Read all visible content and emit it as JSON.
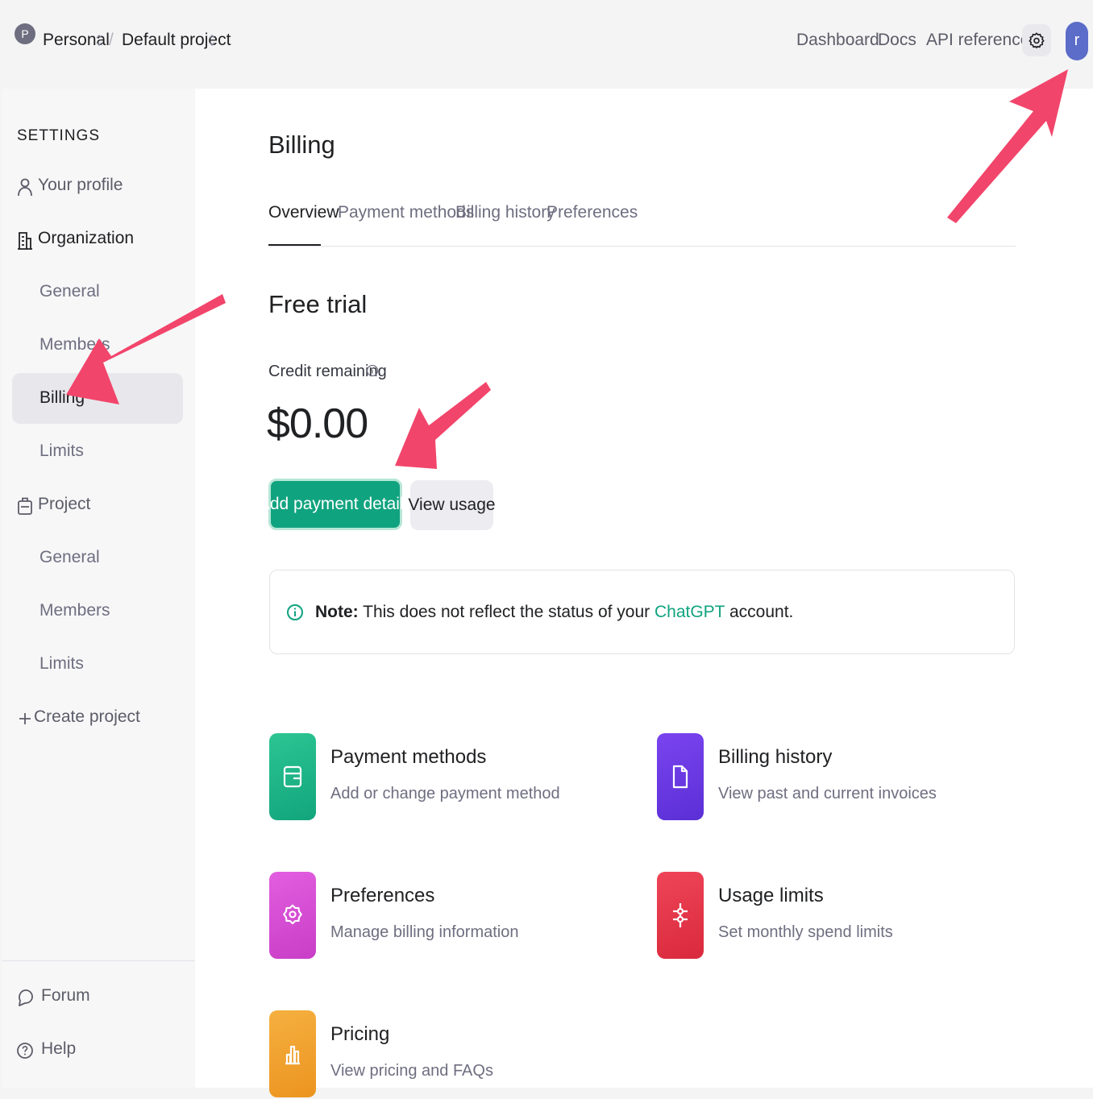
{
  "topbar": {
    "org_initial": "P",
    "org_name": "Personal",
    "project_name": "Default project",
    "separator": "/",
    "nav": [
      "Dashboard",
      "Docs",
      "API reference"
    ],
    "user_initial": "r"
  },
  "sidebar": {
    "heading": "SETTINGS",
    "your_profile": "Your profile",
    "organization": "Organization",
    "org_items": [
      "General",
      "Members",
      "Billing",
      "Limits"
    ],
    "project": "Project",
    "project_items": [
      "General",
      "Members",
      "Limits"
    ],
    "create_project": "Create project",
    "forum": "Forum",
    "help": "Help"
  },
  "main": {
    "title": "Billing",
    "tabs": [
      "Overview",
      "Payment methods",
      "Billing history",
      "Preferences"
    ],
    "active_tab": "Overview",
    "plan": "Free trial",
    "credit_label": "Credit remaining",
    "credit_value": "$0.00",
    "primary_button": "Add payment details",
    "secondary_button": "View usage",
    "note": {
      "prefix": "Note:",
      "text_before": " This does not reflect the status of your ",
      "link": "ChatGPT",
      "text_after": " account."
    },
    "cards": [
      {
        "title": "Payment methods",
        "desc": "Add or change payment method",
        "color": "#19b889",
        "icon": "wallet-icon"
      },
      {
        "title": "Billing history",
        "desc": "View past and current invoices",
        "color": "#6b3ce6",
        "icon": "document-icon"
      },
      {
        "title": "Preferences",
        "desc": "Manage billing information",
        "color": "#d94fd4",
        "icon": "gear-icon"
      },
      {
        "title": "Usage limits",
        "desc": "Set monthly spend limits",
        "color": "#e8344a",
        "icon": "sliders-icon"
      },
      {
        "title": "Pricing",
        "desc": "View pricing and FAQs",
        "color": "#f0a030",
        "icon": "chart-icon"
      }
    ]
  },
  "colors": {
    "accent": "#10a37f",
    "annotation_arrow": "#f2456b",
    "user_avatar": "#5b6cc9"
  }
}
